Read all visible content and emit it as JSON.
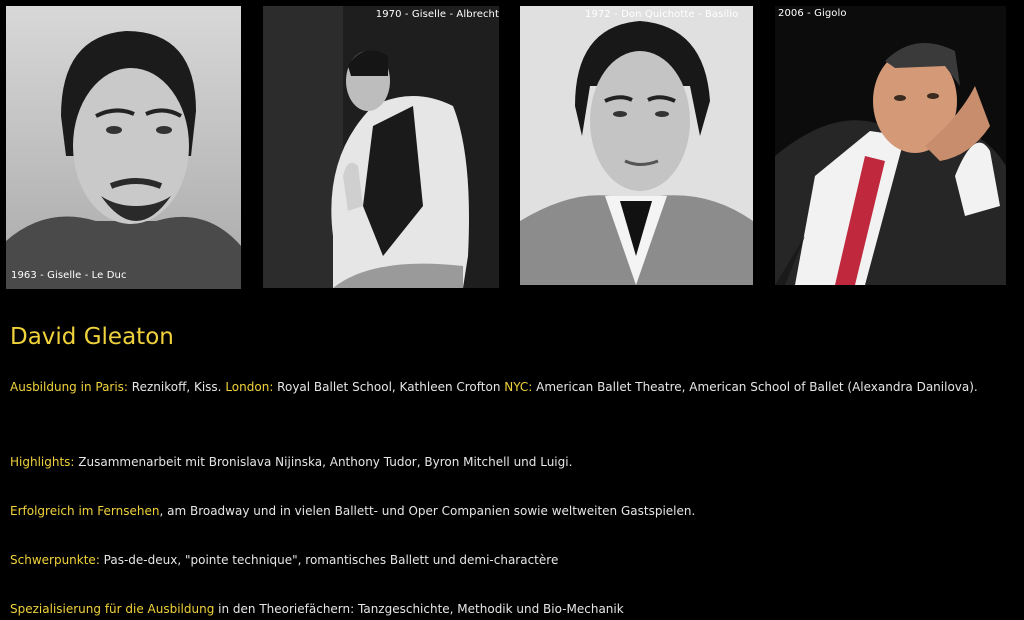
{
  "photos": [
    {
      "caption": "1963 - Giselle - Le Duc"
    },
    {
      "caption": "1970 - Giselle - Albrecht"
    },
    {
      "caption": "1972 - Don Quichotte - Basilio"
    },
    {
      "caption": "2006 - Gigolo"
    }
  ],
  "title": "David Gleaton",
  "paragraphs": {
    "ausbildung": {
      "label_paris": "Ausbildung in Paris:",
      "text_paris": " Reznikoff, Kiss. ",
      "label_london": "London:",
      "text_london": " Royal Ballet School, Kathleen Crofton ",
      "label_nyc": "NYC:",
      "text_nyc": " American Ballet Theatre, American School of Ballet (Alexandra Danilova)."
    },
    "highlights": {
      "label": "Highlights:",
      "text": " Zusammenarbeit mit Bronislava Nijinska, Anthony Tudor, Byron Mitchell und Luigi."
    },
    "erfolg": {
      "label": "Erfolgreich im Fernsehen",
      "text": ", am Broadway und in vielen Ballett- und Oper Companien sowie weltweiten Gastspielen."
    },
    "schwerpunkte": {
      "label": "Schwerpunkte:",
      "text": " Pas-de-deux, \"pointe technique\", romantisches Ballett und demi-charactère"
    },
    "spezialisierung": {
      "label": "Spezialisierung für die Ausbildung",
      "text": " in den Theoriefächern: Tanzgeschichte, Methodik und Bio-Mechanik"
    }
  },
  "colors": {
    "background": "#000000",
    "accent": "#f0d23c",
    "text": "#e6e6e6"
  }
}
